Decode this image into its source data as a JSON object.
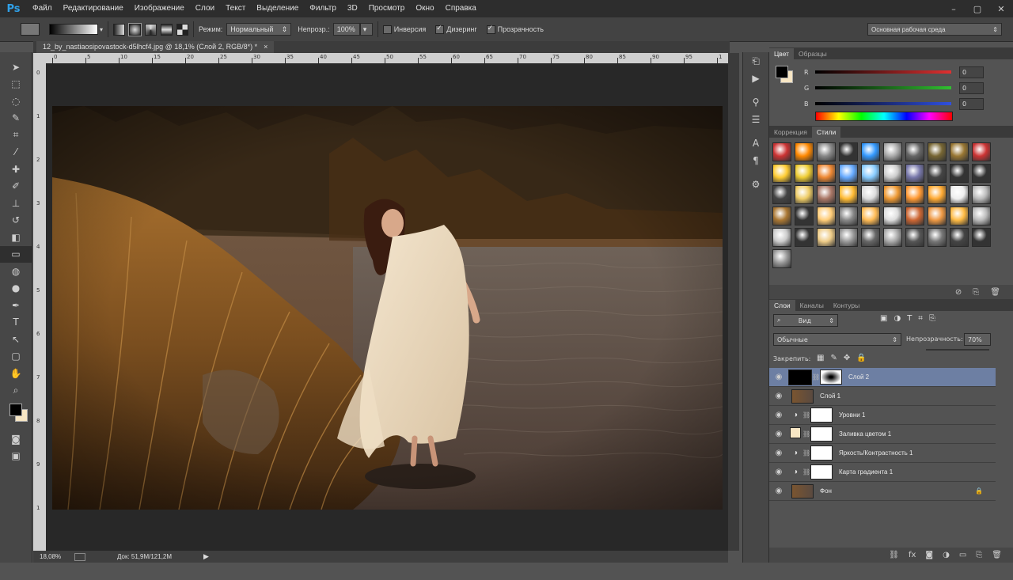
{
  "app": {
    "logo": "Ps"
  },
  "menu": [
    "Файл",
    "Редактирование",
    "Изображение",
    "Слои",
    "Текст",
    "Выделение",
    "Фильтр",
    "3D",
    "Просмотр",
    "Окно",
    "Справка"
  ],
  "window_controls": [
    "–",
    "▢",
    "✕"
  ],
  "options": {
    "mode_label": "Режим:",
    "mode_value": "Нормальный",
    "opacity_label": "Непрозр.:",
    "opacity_value": "100%",
    "inverse_label": "Инверсия",
    "dither_label": "Дизеринг",
    "transparency_label": "Прозрачность",
    "workspace": "Основная рабочая среда"
  },
  "document": {
    "tab_title": "12_by_nastiaosipovastock-d5lhcf4.jpg @ 18,1% (Слой 2, RGB/8*) *",
    "close": "×",
    "zoom": "18,08%",
    "doc_info": "Док: 51,9M/121,2M"
  },
  "ruler": {
    "h_ticks": [
      "0",
      "5",
      "10",
      "15",
      "20",
      "25",
      "30",
      "35",
      "40",
      "45",
      "50",
      "55",
      "60",
      "65",
      "70",
      "75",
      "80",
      "85",
      "90",
      "95",
      "1"
    ],
    "v_ticks": [
      "0",
      "1",
      "2",
      "3",
      "4",
      "5",
      "6",
      "7",
      "8",
      "9",
      "1"
    ]
  },
  "tools": [
    {
      "name": "move-tool",
      "glyph": "➤"
    },
    {
      "name": "marquee-tool",
      "glyph": "⬚"
    },
    {
      "name": "lasso-tool",
      "glyph": "◌"
    },
    {
      "name": "quick-select-tool",
      "glyph": "✎"
    },
    {
      "name": "crop-tool",
      "glyph": "⌗"
    },
    {
      "name": "eyedropper-tool",
      "glyph": "⁄"
    },
    {
      "name": "healing-tool",
      "glyph": "✚"
    },
    {
      "name": "brush-tool",
      "glyph": "✐"
    },
    {
      "name": "stamp-tool",
      "glyph": "⊥"
    },
    {
      "name": "history-brush-tool",
      "glyph": "↺"
    },
    {
      "name": "eraser-tool",
      "glyph": "◧"
    },
    {
      "name": "gradient-tool",
      "glyph": "▭"
    },
    {
      "name": "blur-tool",
      "glyph": "◍"
    },
    {
      "name": "dodge-tool",
      "glyph": "●"
    },
    {
      "name": "pen-tool",
      "glyph": "✒"
    },
    {
      "name": "type-tool",
      "glyph": "T"
    },
    {
      "name": "path-select-tool",
      "glyph": "↖"
    },
    {
      "name": "shape-tool",
      "glyph": "▢"
    },
    {
      "name": "hand-tool",
      "glyph": "✋"
    },
    {
      "name": "zoom-tool",
      "glyph": "⌕"
    }
  ],
  "color_panel": {
    "tabs": [
      "Цвет",
      "Образцы"
    ],
    "rows": [
      {
        "label": "R",
        "value": "0",
        "color": "#e03030"
      },
      {
        "label": "G",
        "value": "0",
        "color": "#30c030"
      },
      {
        "label": "B",
        "value": "0",
        "color": "#3050e0"
      }
    ]
  },
  "styles_panel": {
    "tabs": [
      "Коррекция",
      "Стили"
    ]
  },
  "layers_panel": {
    "tabs": [
      "Слои",
      "Каналы",
      "Контуры"
    ],
    "filter": "Вид",
    "blend_mode": "Обычные",
    "opacity_label": "Непрозрачность:",
    "opacity_value": "70%",
    "lock_label": "Закрепить:",
    "layers": [
      {
        "name": "Слой 2",
        "type": "mask",
        "selected": true
      },
      {
        "name": "Слой 1",
        "type": "photo",
        "selected": false
      },
      {
        "name": "Уровни 1",
        "type": "adjust",
        "selected": false
      },
      {
        "name": "Заливка цветом 1",
        "type": "fill",
        "selected": false
      },
      {
        "name": "Яркость/Контрастность 1",
        "type": "adjust",
        "selected": false
      },
      {
        "name": "Карта градиента 1",
        "type": "adjust",
        "selected": false
      },
      {
        "name": "Фон",
        "type": "background",
        "selected": false
      }
    ]
  },
  "colors": {
    "accent": "#6d7fa3",
    "panel": "#535353",
    "dark": "#2d2d2d",
    "ps_blue": "#2fa0e8"
  }
}
